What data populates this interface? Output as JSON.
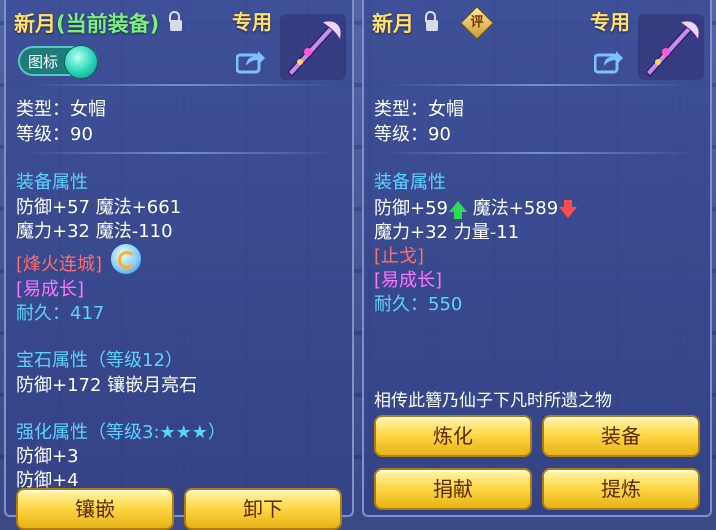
{
  "left": {
    "title_name": "新月",
    "title_current": "(当前装备)",
    "exclusive": "专用",
    "toggle_label": "图标",
    "type_line": "类型：女帽",
    "level_line": "等级：90",
    "equip_attr_header": "装备属性",
    "attr_line1": "防御+57 魔法+661",
    "attr_line2": "魔力+32 魔法-110",
    "skill": "[烽火连城]",
    "trait": "[易成长]",
    "durability_label": "耐久：",
    "durability_value": "417",
    "gem_header": "宝石属性（等级12）",
    "gem_line": "防御+172 镶嵌月亮石",
    "strengthen_header": "强化属性（等级3:★★★）",
    "strengthen_line1": "防御+3",
    "strengthen_line2": "防御+4",
    "buttons": [
      "镶嵌",
      "卸下"
    ]
  },
  "right": {
    "title_name": "新月",
    "eval_badge": "评",
    "exclusive": "专用",
    "type_line": "类型：女帽",
    "level_line": "等级：90",
    "equip_attr_header": "装备属性",
    "attr_def": "防御+59",
    "attr_magic": "魔法+589",
    "attr_line2": "魔力+32 力量-11",
    "skill": "[止戈]",
    "trait": "[易成长]",
    "durability_label": "耐久：",
    "durability_value": "550",
    "description": "相传此簪乃仙子下凡时所遗之物",
    "buttons": [
      "炼化",
      "装备",
      "捐献",
      "提炼"
    ]
  },
  "colors": {
    "title": "#ffe06a",
    "current_tag": "#7cf07c",
    "header": "#5fd1ff",
    "skill": "#ff6d6d",
    "trait": "#ff74ff",
    "button": "#ffd84a"
  },
  "icons": [
    "lock-icon",
    "share-icon",
    "weapon-icon",
    "refresh-icon",
    "arrow-up-icon",
    "arrow-down-icon",
    "eval-badge-icon"
  ]
}
